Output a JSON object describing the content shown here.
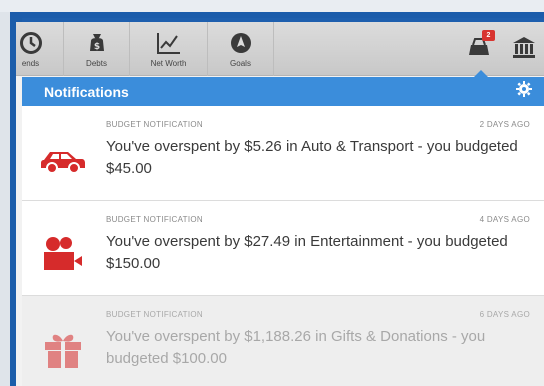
{
  "toolbar": {
    "items": [
      {
        "label": "ends",
        "icon": "clock-icon"
      },
      {
        "label": "Debts",
        "icon": "money-bag-icon"
      },
      {
        "label": "Net Worth",
        "icon": "line-chart-icon"
      },
      {
        "label": "Goals",
        "icon": "compass-icon"
      }
    ],
    "notifications_badge": "2",
    "bank_icon": "bank-icon"
  },
  "notifications": {
    "title": "Notifications",
    "settings_icon": "gear-icon",
    "items": [
      {
        "category": "BUDGET NOTIFICATION",
        "time": "2 DAYS AGO",
        "message": "You've overspent by $5.26 in Auto & Transport - you budgeted $45.00",
        "icon": "car-icon"
      },
      {
        "category": "BUDGET NOTIFICATION",
        "time": "4 DAYS AGO",
        "message": "You've overspent by $27.49 in Entertainment - you budgeted $150.00",
        "icon": "movie-camera-icon"
      },
      {
        "category": "BUDGET NOTIFICATION",
        "time": "6 DAYS AGO",
        "message": "You've overspent by $1,188.26 in Gifts & Donations - you budgeted $100.00",
        "icon": "gift-icon"
      }
    ]
  },
  "colors": {
    "accent": "#3b8ddb",
    "icon_red": "#d62b2b",
    "badge": "#d8342f"
  }
}
